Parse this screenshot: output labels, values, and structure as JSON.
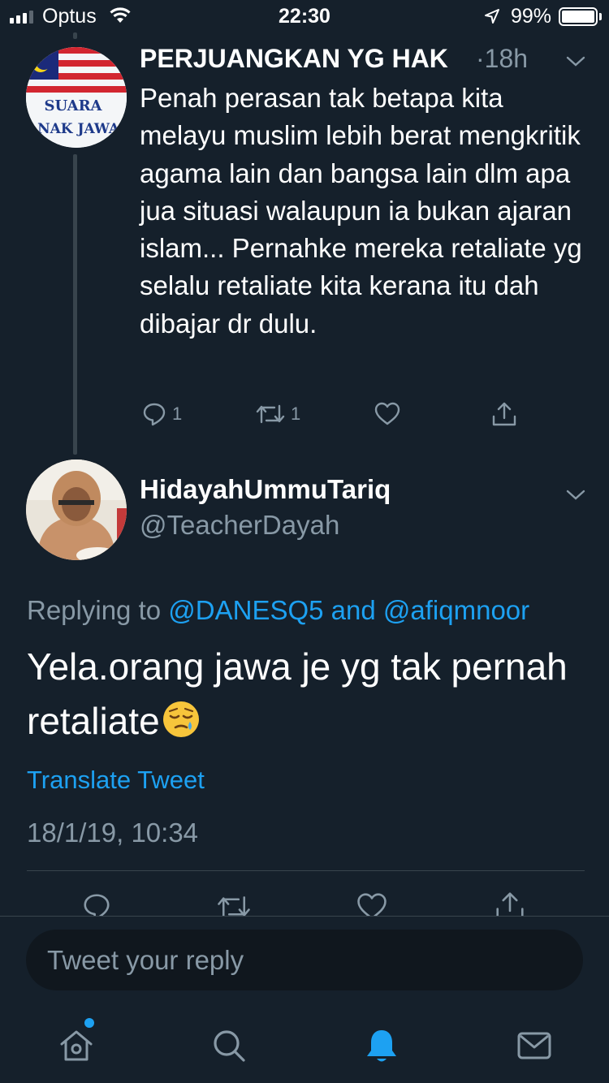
{
  "status_bar": {
    "carrier": "Optus",
    "time": "22:30",
    "battery": "99%",
    "icons": [
      "signal-icon",
      "wifi-icon",
      "location-arrow-icon",
      "battery-icon"
    ]
  },
  "parent_tweet": {
    "author_name": "PERJUANGKAN YG HAK",
    "time_ago": "·18h",
    "avatar_text_line1": "SUARA",
    "avatar_text_line2": "ANAK JAWA",
    "text": "Penah perasan tak betapa kita melayu muslim lebih berat mengkritik agama lain dan bangsa lain dlm apa jua situasi walaupun ia bukan ajaran islam... Pernahke mereka retaliate yg selalu retaliate kita kerana itu dah dibajar dr dulu.",
    "reply_count": "1",
    "retweet_count": "1"
  },
  "main_tweet": {
    "author_name": "HidayahUmmuTariq",
    "handle": "@TeacherDayah",
    "replying_prefix": "Replying to",
    "mention1": "@DANESQ5",
    "replying_and": "and",
    "mention2": "@afiqmnoor",
    "text": "Yela.orang jawa je yg tak pernah retaliate",
    "emoji": "sleepy-face-emoji",
    "translate_label": "Translate Tweet",
    "timestamp": "18/1/19, 10:34"
  },
  "reply_box": {
    "placeholder": "Tweet your reply"
  },
  "tab_bar": {
    "items": [
      "home-icon",
      "search-icon",
      "notifications-icon",
      "messages-icon"
    ],
    "active": "notifications-icon"
  },
  "colors": {
    "background": "#15202b",
    "accent": "#1da1f2",
    "secondary_text": "#8899a6",
    "divider": "#38444d"
  }
}
